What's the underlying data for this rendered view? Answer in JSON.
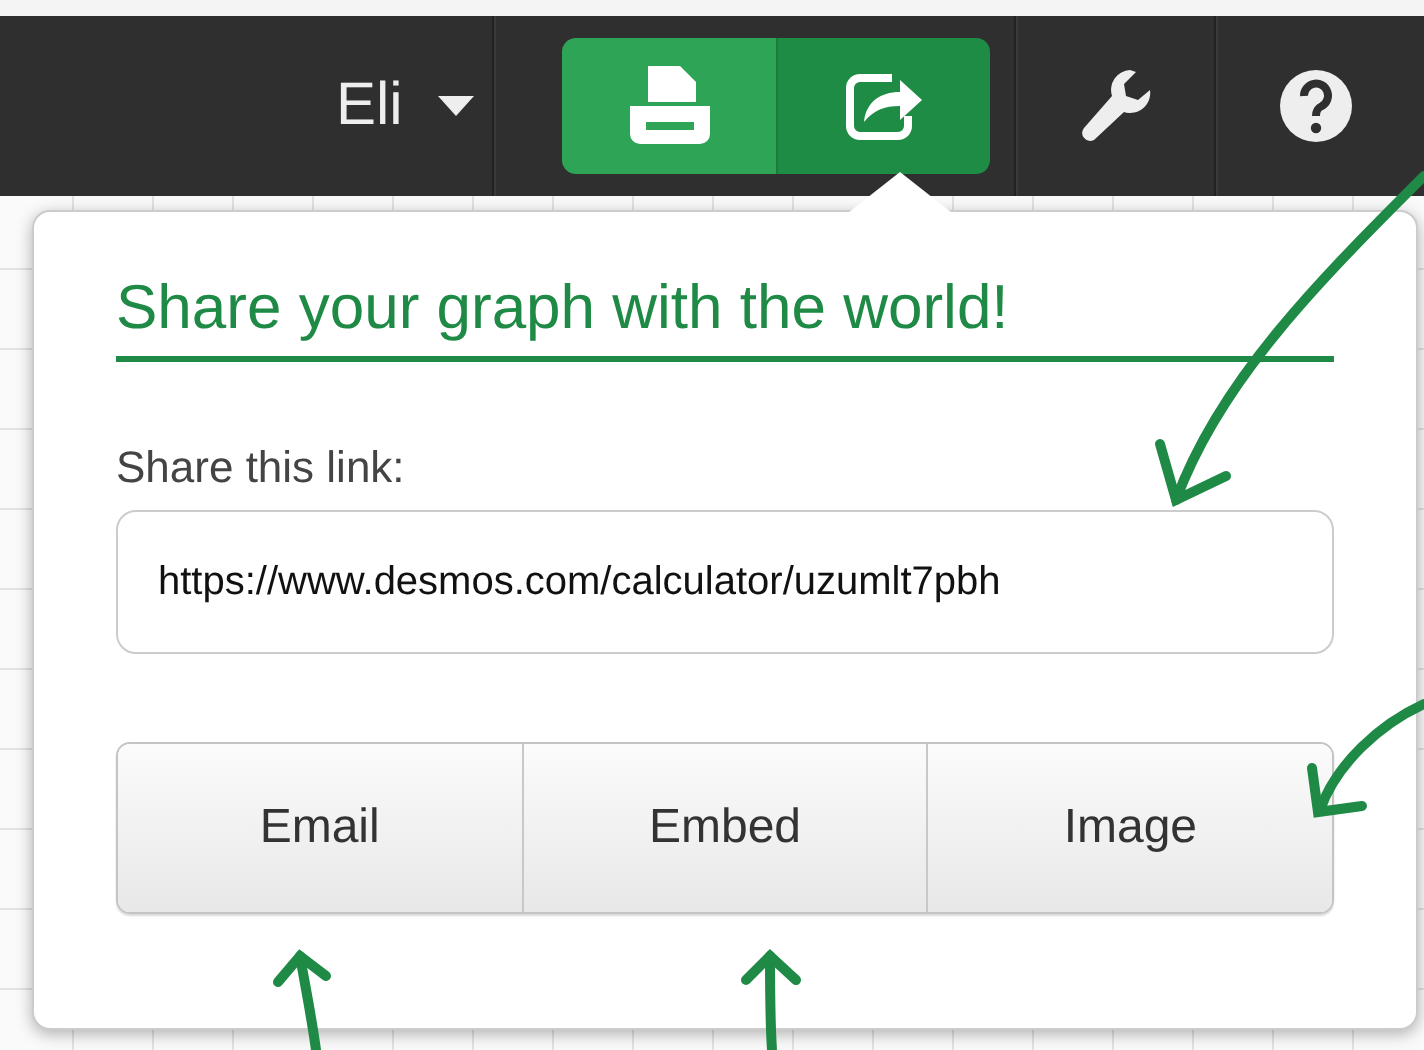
{
  "user_menu": {
    "label": "Eli"
  },
  "toolbar": {
    "actions": [
      {
        "kind": "print",
        "selected": false
      },
      {
        "kind": "share",
        "selected": true
      }
    ]
  },
  "share_popup": {
    "title": "Share your graph with the world!",
    "link_label": "Share this link:",
    "link": "https://www.desmos.com/calculator/uzumlt7pbh",
    "buttons": [
      {
        "label": "Email"
      },
      {
        "label": "Embed"
      },
      {
        "label": "Image"
      }
    ]
  }
}
